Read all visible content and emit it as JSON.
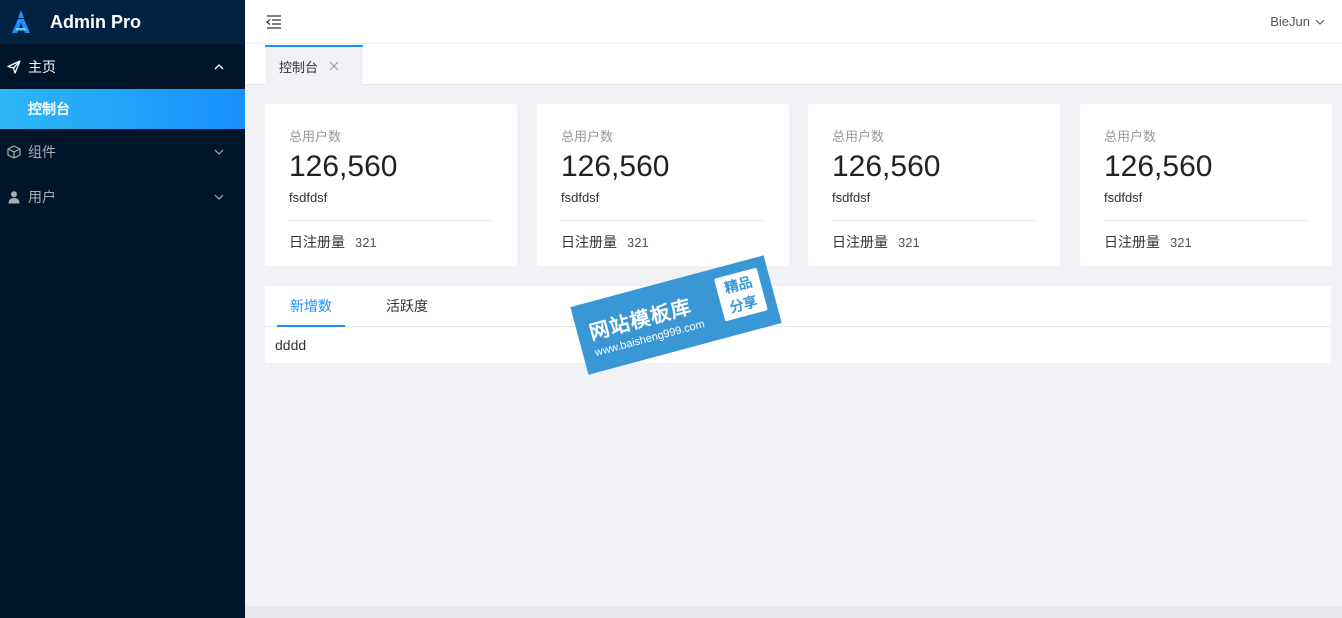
{
  "app": {
    "title": "Admin Pro"
  },
  "sidebar": {
    "groups": [
      {
        "label": "主页",
        "icon": "send-icon",
        "expanded": true,
        "items": [
          {
            "label": "控制台",
            "active": true
          }
        ]
      },
      {
        "label": "组件",
        "icon": "cube-icon",
        "expanded": false
      },
      {
        "label": "用户",
        "icon": "user-icon",
        "expanded": false
      }
    ]
  },
  "header": {
    "user": "BieJun"
  },
  "tabs": [
    {
      "label": "控制台",
      "active": true
    }
  ],
  "cards": [
    {
      "label": "总用户数",
      "value": "126,560",
      "sub": "fsdfdsf",
      "foot_label": "日注册量",
      "foot_value": "321"
    },
    {
      "label": "总用户数",
      "value": "126,560",
      "sub": "fsdfdsf",
      "foot_label": "日注册量",
      "foot_value": "321"
    },
    {
      "label": "总用户数",
      "value": "126,560",
      "sub": "fsdfdsf",
      "foot_label": "日注册量",
      "foot_value": "321"
    },
    {
      "label": "总用户数",
      "value": "126,560",
      "sub": "fsdfdsf",
      "foot_label": "日注册量",
      "foot_value": "321"
    }
  ],
  "panel": {
    "tabs": [
      {
        "label": "新增数",
        "active": true
      },
      {
        "label": "活跃度",
        "active": false
      }
    ],
    "content": "dddd"
  },
  "watermark": {
    "title": "网站模板库",
    "url": "www.baisheng999.com",
    "badge_line1": "精品",
    "badge_line2": "分享"
  },
  "colors": {
    "sidebar_bg": "#001529",
    "accent": "#1890ff",
    "page_bg": "#f0f2f5"
  }
}
